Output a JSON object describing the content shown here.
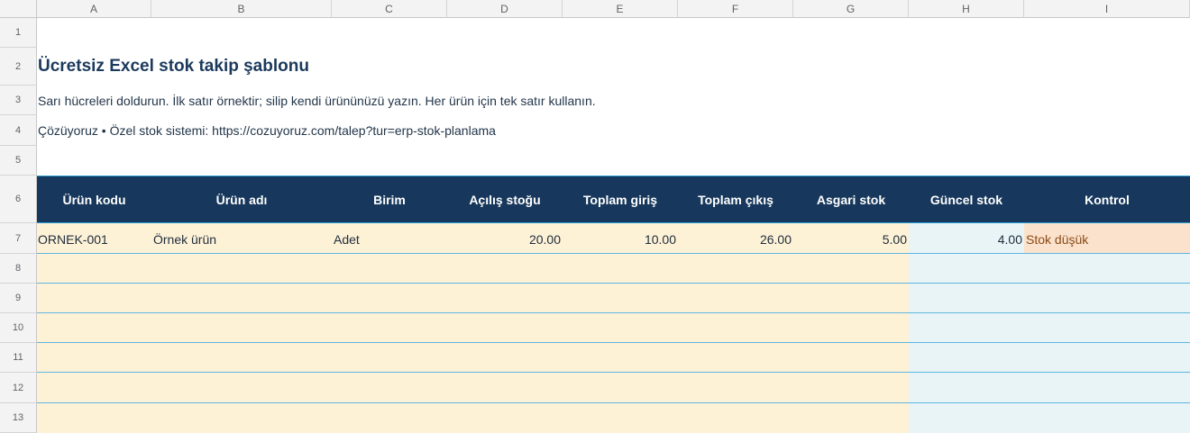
{
  "columns": [
    "A",
    "B",
    "C",
    "D",
    "E",
    "F",
    "G",
    "H",
    "I"
  ],
  "rows": [
    "1",
    "2",
    "3",
    "4",
    "5",
    "6",
    "7",
    "8",
    "9",
    "10",
    "11",
    "12",
    "13"
  ],
  "sheet": {
    "title": "Ücretsiz Excel stok takip şablonu",
    "instructions": "Sarı hücreleri doldurun. İlk satır örnektir; silip kendi ürününüzü yazın. Her ürün için tek satır kullanın.",
    "contact": "Çözüyoruz • Özel stok sistemi: https://cozuyoruz.com/talep?tur=erp-stok-planlama"
  },
  "table": {
    "headers": [
      "Ürün kodu",
      "Ürün adı",
      "Birim",
      "Açılış stoğu",
      "Toplam giriş",
      "Toplam çıkış",
      "Asgari stok",
      "Güncel stok",
      "Kontrol"
    ],
    "example_row": {
      "code": "ORNEK-001",
      "name": "Örnek ürün",
      "unit": "Adet",
      "opening": "20.00",
      "in": "10.00",
      "out": "26.00",
      "min": "5.00",
      "current": "4.00",
      "status": "Stok düşük"
    }
  },
  "colors": {
    "header_bg": "#17385c",
    "input_fill": "#fdf1d6",
    "formula_fill": "#e8f4f5",
    "warning_fill": "#fbe2cc",
    "grid_line": "#5fb6e2"
  }
}
